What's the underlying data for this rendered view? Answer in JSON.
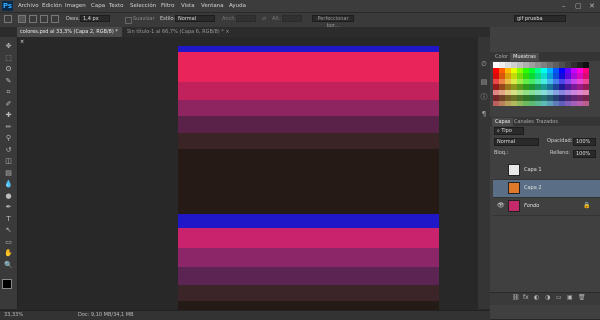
{
  "app": {
    "logo": "Ps"
  },
  "menu": [
    "Archivo",
    "Edición",
    "Imagen",
    "Capa",
    "Texto",
    "Selección",
    "Filtro",
    "Vista",
    "Ventana",
    "Ayuda"
  ],
  "window_buttons": {
    "minimize": "–",
    "restore": "▢",
    "close": "✕"
  },
  "options": {
    "feather_label": "Desv.:",
    "feather_value": "1,4 px",
    "antialias_label": "Suavizar",
    "style_label": "Estilo:",
    "style_value": "Normal",
    "width_label": "Anch.:",
    "height_label": "Alt.:",
    "refine_label": "Perfeccionar bor...",
    "workspace_value": "gif prueba"
  },
  "tabs": [
    {
      "label": "colores.psd al 33,3% (Capa 2, RGB/8) *",
      "close": "×"
    },
    {
      "label": "Sin título-1 al 66,7% (Capa 6, RGB/8) *",
      "close": "×"
    }
  ],
  "tools": [
    "move-icon",
    "marquee-icon",
    "lasso-icon",
    "quick-select-icon",
    "crop-icon",
    "eyedropper-icon",
    "healing-icon",
    "brush-icon",
    "stamp-icon",
    "history-brush-icon",
    "eraser-icon",
    "gradient-icon",
    "blur-icon",
    "dodge-icon",
    "pen-icon",
    "type-icon",
    "path-select-icon",
    "shape-icon",
    "hand-icon",
    "zoom-icon"
  ],
  "tool_glyphs": [
    "✥",
    "⬚",
    "ʘ",
    "✎",
    "⌗",
    "✐",
    "✚",
    "✏",
    "⚲",
    "↺",
    "◫",
    "▤",
    "💧",
    "●",
    "✒",
    "T",
    "↖",
    "▭",
    "✋",
    "🔍"
  ],
  "canvas_stripes": [
    {
      "color": "#1f17c8",
      "flex": 7
    },
    {
      "color": "#e8245a",
      "flex": 34
    },
    {
      "color": "#c1225c",
      "flex": 21
    },
    {
      "color": "#8e2560",
      "flex": 18
    },
    {
      "color": "#5a2249",
      "flex": 20
    },
    {
      "color": "#3a2426",
      "flex": 18
    },
    {
      "color": "#251a16",
      "flex": 75
    },
    {
      "color": "#1f17c8",
      "flex": 16
    },
    {
      "color": "#c9236d",
      "flex": 24
    },
    {
      "color": "#8d2569",
      "flex": 21
    },
    {
      "color": "#5c2452",
      "flex": 21
    },
    {
      "color": "#3c2529",
      "flex": 18
    },
    {
      "color": "#241a16",
      "flex": 12
    }
  ],
  "status": {
    "zoom": "33,33%",
    "doc": "Doc: 9,10 MB/34,1 MB"
  },
  "panel_tabs_top": {
    "color": "Color",
    "swatches": "Muestras"
  },
  "layers_panel": {
    "tabs": [
      "Capas",
      "Canales",
      "Trazados"
    ],
    "kind_label": "Tipo",
    "blend_value": "Normal",
    "opacity_label": "Opacidad:",
    "opacity_value": "100%",
    "lock_label": "Bloq.:",
    "fill_label": "Relleno:",
    "fill_value": "100%",
    "layers": [
      {
        "name": "Capa 1",
        "visible": false,
        "selected": false,
        "thumb": "#e8e8e8"
      },
      {
        "name": "Capa 2",
        "visible": false,
        "selected": true,
        "thumb": "#e0782a"
      },
      {
        "name": "Fondo",
        "visible": true,
        "selected": false,
        "thumb": "#c42a6a"
      }
    ],
    "footer_icons": [
      "link-icon",
      "fx-icon",
      "mask-icon",
      "adjustment-icon",
      "folder-icon",
      "new-layer-icon",
      "trash-icon"
    ],
    "footer_glyphs": [
      "⛓",
      "fx",
      "◐",
      "◑",
      "▭",
      "▣",
      "🗑"
    ]
  },
  "colors": {
    "foreground": "#000000",
    "background": "#ffffff",
    "accent": "#2d7bd8"
  }
}
